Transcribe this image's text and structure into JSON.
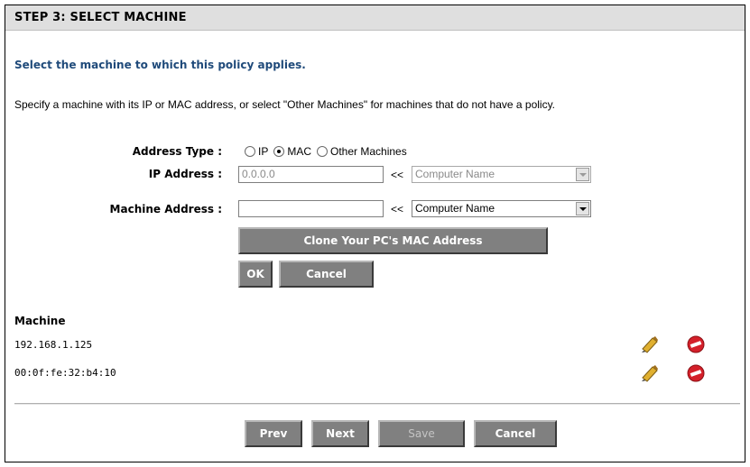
{
  "header": {
    "title": "STEP 3: SELECT MACHINE"
  },
  "subtitle": "Select the machine to which this policy applies.",
  "description": "Specify a machine with its IP or MAC address, or select \"Other Machines\" for machines that do not have a policy.",
  "form": {
    "address_type_label": "Address Type :",
    "address_type_options": [
      {
        "label": "IP",
        "selected": false
      },
      {
        "label": "MAC",
        "selected": true
      },
      {
        "label": "Other Machines",
        "selected": false
      }
    ],
    "ip_address_label": "IP Address :",
    "ip_address_value": "0.0.0.0",
    "ip_computer_name": "Computer Name",
    "machine_address_label": "Machine Address :",
    "machine_address_value": "",
    "machine_computer_name": "Computer Name",
    "arrow_text": "<<",
    "clone_button": "Clone Your PC's MAC Address",
    "ok_button": "OK",
    "cancel_button": "Cancel"
  },
  "machine_list": {
    "title": "Machine",
    "rows": [
      {
        "address": "192.168.1.125"
      },
      {
        "address": "00:0f:fe:32:b4:10"
      }
    ]
  },
  "footer": {
    "prev": "Prev",
    "next": "Next",
    "save": "Save",
    "cancel": "Cancel"
  },
  "colors": {
    "subtitle": "#1f4a7a",
    "button": "#808080",
    "delete_icon": "#d4202a",
    "edit_icon": "#e0b030"
  }
}
